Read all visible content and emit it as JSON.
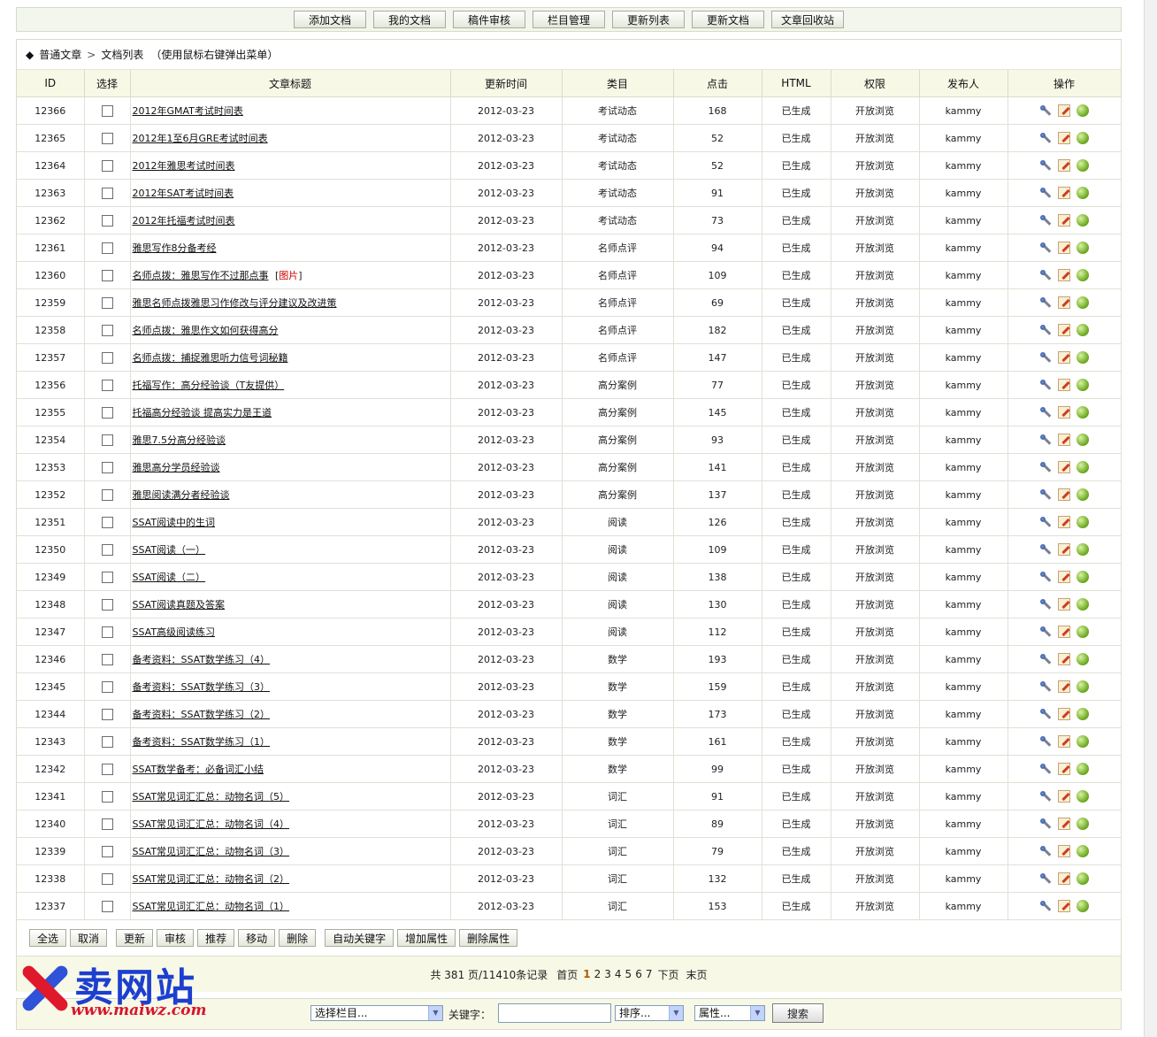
{
  "toolbar": {
    "buttons": [
      "添加文档",
      "我的文档",
      "稿件审核",
      "栏目管理",
      "更新列表",
      "更新文档",
      "文章回收站"
    ]
  },
  "breadcrumb": {
    "root": "普通文章",
    "current": "文档列表",
    "hint": "（使用鼠标右键弹出菜单）"
  },
  "table": {
    "headers": [
      "ID",
      "选择",
      "文章标题",
      "更新时间",
      "类目",
      "点击",
      "HTML",
      "权限",
      "发布人",
      "操作"
    ],
    "rows": [
      {
        "id": "12366",
        "title": "2012年GMAT考试时间表",
        "pic": "",
        "date": "2012-03-23",
        "cat": "考试动态",
        "clicks": "168",
        "html": "已生成",
        "perm": "开放浏览",
        "pub": "kammy"
      },
      {
        "id": "12365",
        "title": "2012年1至6月GRE考试时间表",
        "pic": "",
        "date": "2012-03-23",
        "cat": "考试动态",
        "clicks": "52",
        "html": "已生成",
        "perm": "开放浏览",
        "pub": "kammy"
      },
      {
        "id": "12364",
        "title": "2012年雅思考试时间表",
        "pic": "",
        "date": "2012-03-23",
        "cat": "考试动态",
        "clicks": "52",
        "html": "已生成",
        "perm": "开放浏览",
        "pub": "kammy"
      },
      {
        "id": "12363",
        "title": "2012年SAT考试时间表",
        "pic": "",
        "date": "2012-03-23",
        "cat": "考试动态",
        "clicks": "91",
        "html": "已生成",
        "perm": "开放浏览",
        "pub": "kammy"
      },
      {
        "id": "12362",
        "title": "2012年托福考试时间表",
        "pic": "",
        "date": "2012-03-23",
        "cat": "考试动态",
        "clicks": "73",
        "html": "已生成",
        "perm": "开放浏览",
        "pub": "kammy"
      },
      {
        "id": "12361",
        "title": "雅思写作8分备考经",
        "pic": "",
        "date": "2012-03-23",
        "cat": "名师点评",
        "clicks": "94",
        "html": "已生成",
        "perm": "开放浏览",
        "pub": "kammy"
      },
      {
        "id": "12360",
        "title": "名师点拨：雅思写作不过那点事",
        "pic": "图片",
        "date": "2012-03-23",
        "cat": "名师点评",
        "clicks": "109",
        "html": "已生成",
        "perm": "开放浏览",
        "pub": "kammy"
      },
      {
        "id": "12359",
        "title": "雅思名师点拨雅思习作修改与评分建议及改进策",
        "pic": "",
        "date": "2012-03-23",
        "cat": "名师点评",
        "clicks": "69",
        "html": "已生成",
        "perm": "开放浏览",
        "pub": "kammy"
      },
      {
        "id": "12358",
        "title": "名师点拨：雅思作文如何获得高分",
        "pic": "",
        "date": "2012-03-23",
        "cat": "名师点评",
        "clicks": "182",
        "html": "已生成",
        "perm": "开放浏览",
        "pub": "kammy"
      },
      {
        "id": "12357",
        "title": "名师点拨：捕捉雅思听力信号词秘籍",
        "pic": "",
        "date": "2012-03-23",
        "cat": "名师点评",
        "clicks": "147",
        "html": "已生成",
        "perm": "开放浏览",
        "pub": "kammy"
      },
      {
        "id": "12356",
        "title": "托福写作：高分经验谈（T友提供）",
        "pic": "",
        "date": "2012-03-23",
        "cat": "高分案例",
        "clicks": "77",
        "html": "已生成",
        "perm": "开放浏览",
        "pub": "kammy"
      },
      {
        "id": "12355",
        "title": "托福高分经验谈 提高实力是王道",
        "pic": "",
        "date": "2012-03-23",
        "cat": "高分案例",
        "clicks": "145",
        "html": "已生成",
        "perm": "开放浏览",
        "pub": "kammy"
      },
      {
        "id": "12354",
        "title": "雅思7.5分高分经验谈",
        "pic": "",
        "date": "2012-03-23",
        "cat": "高分案例",
        "clicks": "93",
        "html": "已生成",
        "perm": "开放浏览",
        "pub": "kammy"
      },
      {
        "id": "12353",
        "title": "雅思高分学员经验谈",
        "pic": "",
        "date": "2012-03-23",
        "cat": "高分案例",
        "clicks": "141",
        "html": "已生成",
        "perm": "开放浏览",
        "pub": "kammy"
      },
      {
        "id": "12352",
        "title": "雅思阅读满分者经验谈",
        "pic": "",
        "date": "2012-03-23",
        "cat": "高分案例",
        "clicks": "137",
        "html": "已生成",
        "perm": "开放浏览",
        "pub": "kammy"
      },
      {
        "id": "12351",
        "title": "SSAT阅读中的生词",
        "pic": "",
        "date": "2012-03-23",
        "cat": "阅读",
        "clicks": "126",
        "html": "已生成",
        "perm": "开放浏览",
        "pub": "kammy"
      },
      {
        "id": "12350",
        "title": "SSAT阅读（一）",
        "pic": "",
        "date": "2012-03-23",
        "cat": "阅读",
        "clicks": "109",
        "html": "已生成",
        "perm": "开放浏览",
        "pub": "kammy"
      },
      {
        "id": "12349",
        "title": "SSAT阅读（二）",
        "pic": "",
        "date": "2012-03-23",
        "cat": "阅读",
        "clicks": "138",
        "html": "已生成",
        "perm": "开放浏览",
        "pub": "kammy"
      },
      {
        "id": "12348",
        "title": "SSAT阅读真题及答案",
        "pic": "",
        "date": "2012-03-23",
        "cat": "阅读",
        "clicks": "130",
        "html": "已生成",
        "perm": "开放浏览",
        "pub": "kammy"
      },
      {
        "id": "12347",
        "title": "SSAT高级阅读练习",
        "pic": "",
        "date": "2012-03-23",
        "cat": "阅读",
        "clicks": "112",
        "html": "已生成",
        "perm": "开放浏览",
        "pub": "kammy"
      },
      {
        "id": "12346",
        "title": "备考资料：SSAT数学练习（4）",
        "pic": "",
        "date": "2012-03-23",
        "cat": "数学",
        "clicks": "193",
        "html": "已生成",
        "perm": "开放浏览",
        "pub": "kammy"
      },
      {
        "id": "12345",
        "title": "备考资料：SSAT数学练习（3）",
        "pic": "",
        "date": "2012-03-23",
        "cat": "数学",
        "clicks": "159",
        "html": "已生成",
        "perm": "开放浏览",
        "pub": "kammy"
      },
      {
        "id": "12344",
        "title": "备考资料：SSAT数学练习（2）",
        "pic": "",
        "date": "2012-03-23",
        "cat": "数学",
        "clicks": "173",
        "html": "已生成",
        "perm": "开放浏览",
        "pub": "kammy"
      },
      {
        "id": "12343",
        "title": "备考资料：SSAT数学练习（1）",
        "pic": "",
        "date": "2012-03-23",
        "cat": "数学",
        "clicks": "161",
        "html": "已生成",
        "perm": "开放浏览",
        "pub": "kammy"
      },
      {
        "id": "12342",
        "title": "SSAT数学备考：必备词汇小结",
        "pic": "",
        "date": "2012-03-23",
        "cat": "数学",
        "clicks": "99",
        "html": "已生成",
        "perm": "开放浏览",
        "pub": "kammy"
      },
      {
        "id": "12341",
        "title": "SSAT常见词汇汇总：动物名词（5）",
        "pic": "",
        "date": "2012-03-23",
        "cat": "词汇",
        "clicks": "91",
        "html": "已生成",
        "perm": "开放浏览",
        "pub": "kammy"
      },
      {
        "id": "12340",
        "title": "SSAT常见词汇汇总：动物名词（4）",
        "pic": "",
        "date": "2012-03-23",
        "cat": "词汇",
        "clicks": "89",
        "html": "已生成",
        "perm": "开放浏览",
        "pub": "kammy"
      },
      {
        "id": "12339",
        "title": "SSAT常见词汇汇总：动物名词（3）",
        "pic": "",
        "date": "2012-03-23",
        "cat": "词汇",
        "clicks": "79",
        "html": "已生成",
        "perm": "开放浏览",
        "pub": "kammy"
      },
      {
        "id": "12338",
        "title": "SSAT常见词汇汇总：动物名词（2）",
        "pic": "",
        "date": "2012-03-23",
        "cat": "词汇",
        "clicks": "132",
        "html": "已生成",
        "perm": "开放浏览",
        "pub": "kammy"
      },
      {
        "id": "12337",
        "title": "SSAT常见词汇汇总：动物名词（1）",
        "pic": "",
        "date": "2012-03-23",
        "cat": "词汇",
        "clicks": "153",
        "html": "已生成",
        "perm": "开放浏览",
        "pub": "kammy"
      }
    ]
  },
  "actions": {
    "buttons": [
      "全选",
      "取消",
      "更新",
      "审核",
      "推荐",
      "移动",
      "删除",
      "自动关键字",
      "增加属性",
      "删除属性"
    ]
  },
  "pager": {
    "summary": "共 381 页/11410条记录",
    "first": "首页",
    "pages": [
      "1",
      "2",
      "3",
      "4",
      "5",
      "6",
      "7"
    ],
    "current": "1",
    "next": "下页",
    "last": "末页"
  },
  "search": {
    "column_select": "选择栏目...",
    "keyword_label": "关键字：",
    "keyword_value": "",
    "sort_select": "排序...",
    "attr_select": "属性...",
    "submit": "搜索"
  },
  "watermark": {
    "name": "卖网站",
    "url": "www.maiwz.com"
  },
  "colors": {
    "header_bg": "#f7f8e6",
    "border": "#d6dccd",
    "pic_tag": "#cc0000",
    "watermark_blue": "#1d3fcf",
    "watermark_red": "#d8152b"
  }
}
